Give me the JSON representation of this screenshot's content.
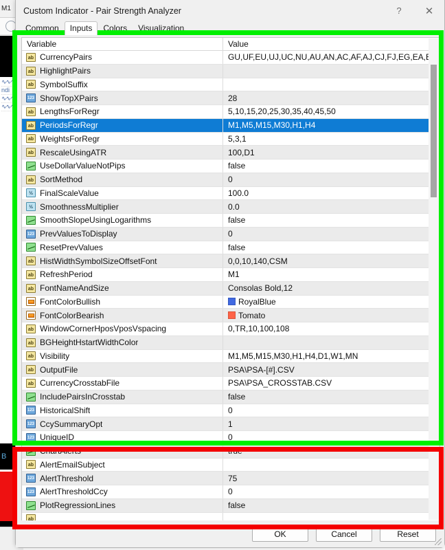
{
  "background": {
    "toolbar_label": "M1",
    "navigator_items": [
      "ndi",
      "",
      ""
    ],
    "chart_label": "B"
  },
  "window": {
    "title": "Custom Indicator - Pair Strength Analyzer",
    "help_button": "?",
    "close_button": "✕"
  },
  "tabs": [
    {
      "label": "Common",
      "active": false
    },
    {
      "label": "Inputs",
      "active": true
    },
    {
      "label": "Colors",
      "active": false
    },
    {
      "label": "Visualization",
      "active": false
    }
  ],
  "table": {
    "headers": {
      "variable": "Variable",
      "value": "Value"
    },
    "rows": [
      {
        "icon": "string-icon",
        "type": "str",
        "name": "CurrencyPairs",
        "value": "GU,UF,EU,UJ,UC,NU,AU,AN,AC,AF,AJ,CJ,FJ,EG,EA,EF,E...",
        "selected": false
      },
      {
        "icon": "string-icon",
        "type": "str",
        "name": "HighlightPairs",
        "value": "",
        "selected": false
      },
      {
        "icon": "string-icon",
        "type": "str",
        "name": "SymbolSuffix",
        "value": "",
        "selected": false
      },
      {
        "icon": "integer-icon",
        "type": "int",
        "name": "ShowTopXPairs",
        "value": "28",
        "selected": false
      },
      {
        "icon": "string-icon",
        "type": "str",
        "name": "LengthsForRegr",
        "value": "5,10,15,20,25,30,35,40,45,50",
        "selected": false
      },
      {
        "icon": "string-icon",
        "type": "str",
        "name": "PeriodsForRegr",
        "value": "M1,M5,M15,M30,H1,H4",
        "selected": true
      },
      {
        "icon": "string-icon",
        "type": "str",
        "name": "WeightsForRegr",
        "value": "5,3,1",
        "selected": false
      },
      {
        "icon": "string-icon",
        "type": "str",
        "name": "RescaleUsingATR",
        "value": "100,D1",
        "selected": false
      },
      {
        "icon": "boolean-icon",
        "type": "bool",
        "name": "UseDollarValueNotPips",
        "value": "false",
        "selected": false
      },
      {
        "icon": "string-icon",
        "type": "str",
        "name": "SortMethod",
        "value": "0",
        "selected": false
      },
      {
        "icon": "double-icon",
        "type": "dbl",
        "name": "FinalScaleValue",
        "value": "100.0",
        "selected": false
      },
      {
        "icon": "double-icon",
        "type": "dbl",
        "name": "SmoothnessMultiplier",
        "value": "0.0",
        "selected": false
      },
      {
        "icon": "boolean-icon",
        "type": "bool",
        "name": "SmoothSlopeUsingLogarithms",
        "value": "false",
        "selected": false
      },
      {
        "icon": "integer-icon",
        "type": "int",
        "name": "PrevValuesToDisplay",
        "value": "0",
        "selected": false
      },
      {
        "icon": "boolean-icon",
        "type": "bool",
        "name": "ResetPrevValues",
        "value": "false",
        "selected": false
      },
      {
        "icon": "string-icon",
        "type": "str",
        "name": "HistWidthSymbolSizeOffsetFont",
        "value": "0,0,10,140,CSM",
        "selected": false
      },
      {
        "icon": "string-icon",
        "type": "str",
        "name": "RefreshPeriod",
        "value": "M1",
        "selected": false
      },
      {
        "icon": "string-icon",
        "type": "str",
        "name": "FontNameAndSize",
        "value": "Consolas Bold,12",
        "selected": false
      },
      {
        "icon": "color-icon",
        "type": "color",
        "name": "FontColorBullish",
        "value": "RoyalBlue",
        "swatch": "#4169E1",
        "selected": false
      },
      {
        "icon": "color-icon",
        "type": "color",
        "name": "FontColorBearish",
        "value": "Tomato",
        "swatch": "#FF6347",
        "selected": false
      },
      {
        "icon": "string-icon",
        "type": "str",
        "name": "WindowCornerHposVposVspacing",
        "value": "0,TR,10,100,108",
        "selected": false
      },
      {
        "icon": "string-icon",
        "type": "str",
        "name": "BGHeightHstartWidthColor",
        "value": "",
        "selected": false
      },
      {
        "icon": "string-icon",
        "type": "str",
        "name": "Visibility",
        "value": "M1,M5,M15,M30,H1,H4,D1,W1,MN",
        "selected": false
      },
      {
        "icon": "string-icon",
        "type": "str",
        "name": "OutputFile",
        "value": "PSA\\PSA-[#].CSV",
        "selected": false
      },
      {
        "icon": "string-icon",
        "type": "str",
        "name": "CurrencyCrosstabFile",
        "value": "PSA\\PSA_CROSSTAB.CSV",
        "selected": false
      },
      {
        "icon": "boolean-icon",
        "type": "bool",
        "name": "IncludePairsInCrosstab",
        "value": "false",
        "selected": false
      },
      {
        "icon": "integer-icon",
        "type": "int",
        "name": "HistoricalShift",
        "value": "0",
        "selected": false
      },
      {
        "icon": "integer-icon",
        "type": "int",
        "name": "CcySummaryOpt",
        "value": "1",
        "selected": false
      },
      {
        "icon": "integer-icon",
        "type": "int",
        "name": "UniqueID",
        "value": "0",
        "selected": false
      },
      {
        "icon": "boolean-icon",
        "type": "bool",
        "name": "ChartAlerts",
        "value": "true",
        "selected": false
      },
      {
        "icon": "string-icon",
        "type": "str",
        "name": "AlertEmailSubject",
        "value": "",
        "selected": false
      },
      {
        "icon": "integer-icon",
        "type": "int",
        "name": "AlertThreshold",
        "value": "75",
        "selected": false
      },
      {
        "icon": "integer-icon",
        "type": "int",
        "name": "AlertThresholdCcy",
        "value": "0",
        "selected": false
      },
      {
        "icon": "boolean-icon",
        "type": "bool",
        "name": "PlotRegressionLines",
        "value": "false",
        "selected": false
      },
      {
        "icon": "string-icon",
        "type": "str",
        "name": "",
        "value": "",
        "selected": false
      }
    ]
  },
  "footer": {
    "ok_label": "OK",
    "cancel_label": "Cancel",
    "reset_label": "Reset"
  },
  "annotations": {
    "green_box_color": "#00ef00",
    "red_box_color": "#f40000"
  }
}
